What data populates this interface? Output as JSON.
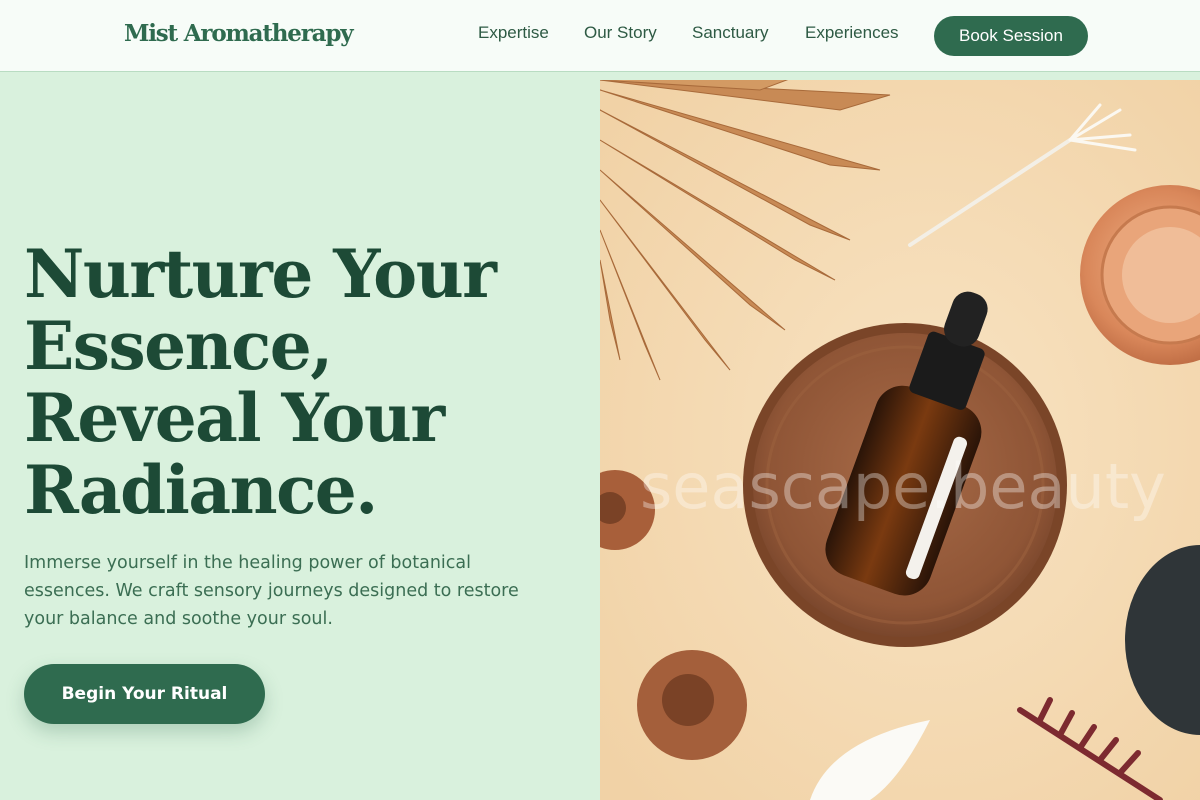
{
  "brand": {
    "logo_text": "Mist Aromatherapy"
  },
  "nav": {
    "links": [
      {
        "label": "Expertise"
      },
      {
        "label": "Our Story"
      },
      {
        "label": "Sanctuary"
      },
      {
        "label": "Experiences"
      }
    ],
    "book_label": "Book Session"
  },
  "hero": {
    "title_lines": [
      "Nurture Your",
      "Essence,",
      "Reveal Your",
      "Radiance."
    ],
    "description": "Immerse yourself in the healing power of botanical essences. We craft sensory journeys designed to restore your balance and soothe your soul.",
    "cta_label": "Begin Your Ritual"
  },
  "image": {
    "watermark": "seascape.beauty"
  },
  "colors": {
    "primary": "#2f6b4f",
    "heading": "#1d4a36",
    "background": "#d9f1dd",
    "header_bg": "#f7fcf8",
    "image_bg": "#f5dcb5"
  }
}
